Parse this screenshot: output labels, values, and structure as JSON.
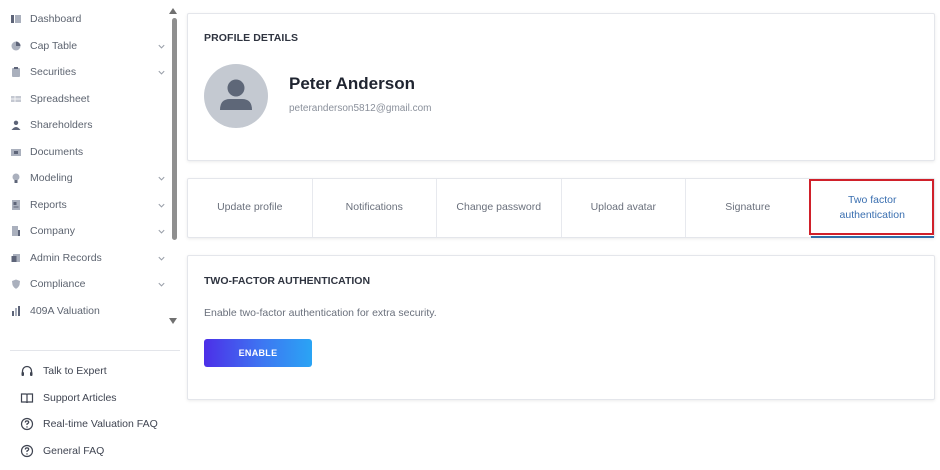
{
  "sidebar": {
    "nav_items": [
      {
        "label": "Dashboard",
        "icon": "dashboard-icon",
        "has_chevron": false
      },
      {
        "label": "Cap Table",
        "icon": "pie-chart-icon",
        "has_chevron": true
      },
      {
        "label": "Securities",
        "icon": "clipboard-icon",
        "has_chevron": true
      },
      {
        "label": "Spreadsheet",
        "icon": "spreadsheet-icon",
        "has_chevron": false
      },
      {
        "label": "Shareholders",
        "icon": "person-icon",
        "has_chevron": false
      },
      {
        "label": "Documents",
        "icon": "folder-icon",
        "has_chevron": false
      },
      {
        "label": "Modeling",
        "icon": "lightbulb-icon",
        "has_chevron": true
      },
      {
        "label": "Reports",
        "icon": "report-icon",
        "has_chevron": true
      },
      {
        "label": "Company",
        "icon": "building-icon",
        "has_chevron": true
      },
      {
        "label": "Admin Records",
        "icon": "records-icon",
        "has_chevron": true
      },
      {
        "label": "Compliance",
        "icon": "shield-icon",
        "has_chevron": true
      },
      {
        "label": "409A Valuation",
        "icon": "valuation-icon",
        "has_chevron": false
      }
    ],
    "help_items": [
      {
        "label": "Talk to Expert",
        "icon": "headset-icon"
      },
      {
        "label": "Support Articles",
        "icon": "book-icon"
      },
      {
        "label": "Real-time Valuation FAQ",
        "icon": "question-circle-icon"
      },
      {
        "label": "General FAQ",
        "icon": "question-circle-icon"
      }
    ]
  },
  "profile": {
    "section_title": "PROFILE DETAILS",
    "name": "Peter Anderson",
    "email": "peteranderson5812@gmail.com"
  },
  "tabs": [
    {
      "label": "Update profile",
      "active": false
    },
    {
      "label": "Notifications",
      "active": false
    },
    {
      "label": "Change password",
      "active": false
    },
    {
      "label": "Upload avatar",
      "active": false
    },
    {
      "label": "Signature",
      "active": false
    },
    {
      "label": "Two factor authentication",
      "active": true
    }
  ],
  "two_factor": {
    "title": "TWO-FACTOR AUTHENTICATION",
    "description": "Enable two-factor authentication for extra security.",
    "button_label": "ENABLE"
  },
  "colors": {
    "accent": "#2f6ea8",
    "highlight_border": "#d0202a",
    "button_gradient_start": "#4c2fe8",
    "button_gradient_end": "#2aa4f4"
  }
}
